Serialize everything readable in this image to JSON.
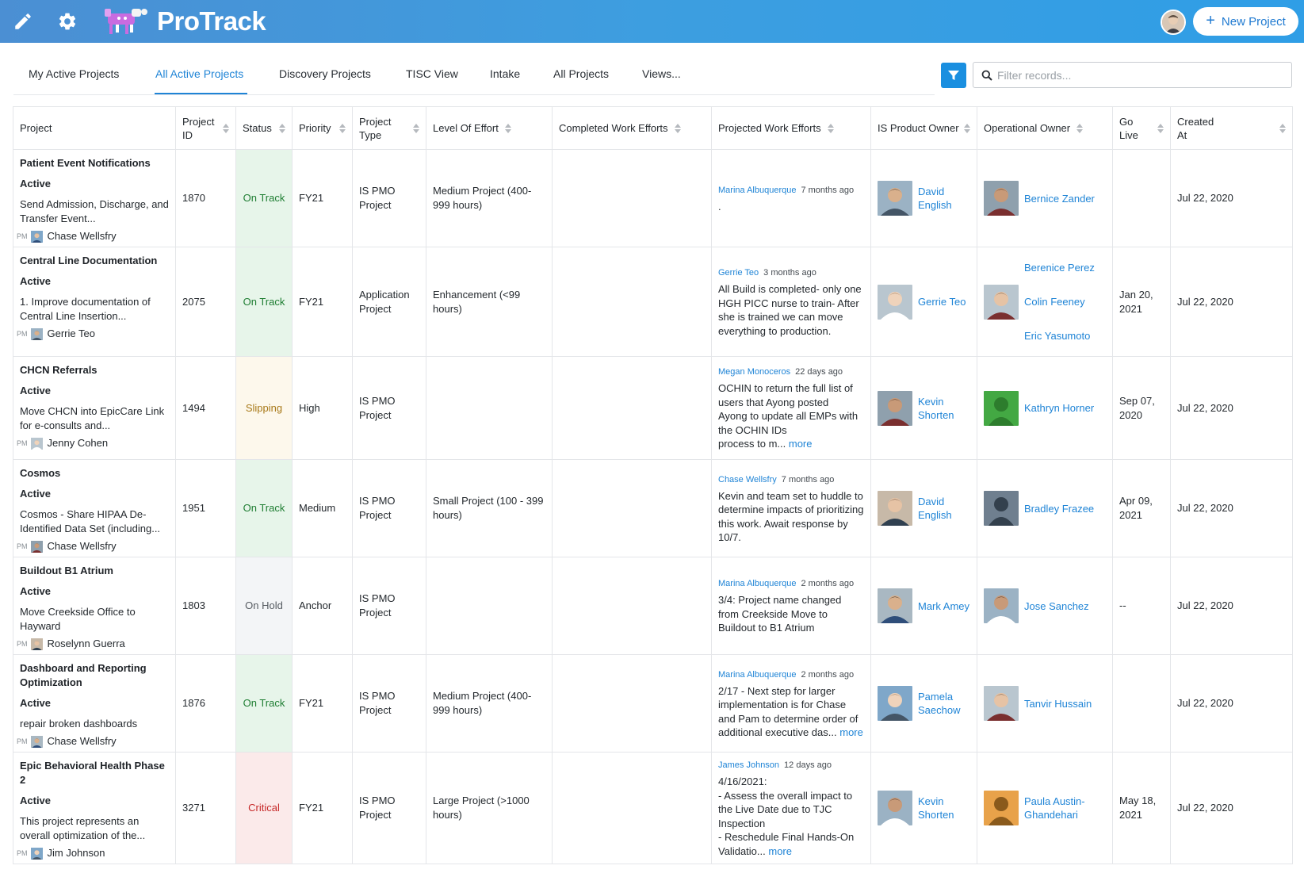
{
  "app": {
    "logo_text": "ProTrack"
  },
  "header": {
    "new_project_label": "New Project"
  },
  "tabs": [
    {
      "label": "My Active Projects"
    },
    {
      "label": "All Active Projects",
      "active": true
    },
    {
      "label": "Discovery Projects"
    },
    {
      "label": "TISC View"
    },
    {
      "label": "Intake"
    },
    {
      "label": "All Projects"
    },
    {
      "label": "Views..."
    }
  ],
  "filter": {
    "placeholder": "Filter records..."
  },
  "columns": {
    "project": "Project",
    "project_id": "Project ID",
    "status": "Status",
    "priority": "Priority",
    "project_type": "Project Type",
    "level_of_effort": "Level Of Effort",
    "completed_work_efforts": "Completed Work Efforts",
    "projected_work_efforts": "Projected Work Efforts",
    "is_product_owner": "IS Product Owner",
    "operational_owner": "Operational Owner",
    "go_live": "Go Live",
    "created_at": "Created At"
  },
  "colors": {
    "header_gradient_start": "#4b8fd3",
    "header_gradient_end": "#2f9ee6",
    "link_blue": "#1f84d6",
    "on_track": "#1e7d32",
    "slipping": "#a87918",
    "on_hold": "#555b61",
    "critical": "#c62828"
  },
  "rows": [
    {
      "name": "Patient Event Notifications",
      "state": "Active",
      "desc": "Send Admission, Discharge, and Transfer Event...",
      "pm_tag": "PM",
      "pm": "Chase Wellsfry",
      "id": "1870",
      "status": "On Track",
      "priority": "FY21",
      "type": "IS PMO Project",
      "effort": "Medium Project (400-999 hours)",
      "completed": "",
      "update_author": "Marina Albuquerque",
      "update_time": "7 months ago",
      "update_text": ".",
      "update_more": "",
      "is_owner": "David English",
      "op_owners": [
        "Bernice Zander"
      ],
      "go_live": "",
      "created": "Jul 22, 2020"
    },
    {
      "name": "Central Line Documentation",
      "state": "Active",
      "desc": "1. Improve documentation of Central Line Insertion...",
      "pm_tag": "PM",
      "pm": "Gerrie Teo",
      "id": "2075",
      "status": "On Track",
      "priority": "FY21",
      "type": "Application Project",
      "effort": "Enhancement (<99 hours)",
      "completed": "",
      "update_author": "Gerrie Teo",
      "update_time": "3 months ago",
      "update_text": "All Build is completed- only one HGH PICC nurse to train- After she is trained we can move everything to production.",
      "update_more": "",
      "is_owner": "Gerrie Teo",
      "op_owners": [
        "Berenice Perez",
        "Colin Feeney",
        "Eric Yasumoto"
      ],
      "go_live": "Jan 20, 2021",
      "created": "Jul 22, 2020"
    },
    {
      "name": "CHCN Referrals",
      "state": "Active",
      "desc": "Move CHCN into EpicCare Link for e-consults and...",
      "pm_tag": "PM",
      "pm": "Jenny Cohen",
      "id": "1494",
      "status": "Slipping",
      "priority": "High",
      "type": "IS PMO Project",
      "effort": "",
      "completed": "",
      "update_author": "Megan Monoceros",
      "update_time": "22 days ago",
      "update_text": "OCHIN to return the full list of users that Ayong posted\nAyong to update all EMPs with the OCHIN IDs\nprocess to m...",
      "update_more": "more",
      "is_owner": "Kevin Shorten",
      "op_owners": [
        "Kathryn Horner"
      ],
      "go_live": "Sep 07, 2020",
      "created": "Jul 22, 2020"
    },
    {
      "name": "Cosmos",
      "state": "Active",
      "desc": "Cosmos - Share HIPAA De-Identified Data Set (including...",
      "pm_tag": "PM",
      "pm": "Chase Wellsfry",
      "id": "1951",
      "status": "On Track",
      "priority": "Medium",
      "type": "IS PMO Project",
      "effort": "Small Project (100 - 399 hours)",
      "completed": "",
      "update_author": "Chase Wellsfry",
      "update_time": "7 months ago",
      "update_text": "Kevin and team set to huddle to determine impacts of prioritizing this work. Await response by 10/7.",
      "update_more": "",
      "is_owner": "David English",
      "op_owners": [
        "Bradley Frazee"
      ],
      "go_live": "Apr 09, 2021",
      "created": "Jul 22, 2020"
    },
    {
      "name": "Buildout B1 Atrium",
      "state": "Active",
      "desc": "Move Creekside Office to Hayward",
      "pm_tag": "PM",
      "pm": "Roselynn Guerra",
      "id": "1803",
      "status": "On Hold",
      "priority": "Anchor",
      "type": "IS PMO Project",
      "effort": "",
      "completed": "",
      "update_author": "Marina Albuquerque",
      "update_time": "2 months ago",
      "update_text": "3/4: Project name changed from Creekside Move to Buildout to B1 Atrium",
      "update_more": "",
      "is_owner": "Mark Amey",
      "op_owners": [
        "Jose Sanchez"
      ],
      "go_live": "--",
      "created": "Jul 22, 2020"
    },
    {
      "name": "Dashboard and Reporting Optimization",
      "state": "Active",
      "desc": "repair broken dashboards",
      "pm_tag": "PM",
      "pm": "Chase Wellsfry",
      "id": "1876",
      "status": "On Track",
      "priority": "FY21",
      "type": "IS PMO Project",
      "effort": "Medium Project (400-999 hours)",
      "completed": "",
      "update_author": "Marina Albuquerque",
      "update_time": "2 months ago",
      "update_text": "2/17 - Next step for larger implementation is for Chase and Pam to determine order of additional executive das...",
      "update_more": "more",
      "is_owner": "Pamela Saechow",
      "op_owners": [
        "Tanvir Hussain"
      ],
      "go_live": "",
      "created": "Jul 22, 2020"
    },
    {
      "name": "Epic Behavioral Health Phase 2",
      "state": "Active",
      "desc": "This project represents an overall optimization of the...",
      "pm_tag": "PM",
      "pm": "Jim Johnson",
      "id": "3271",
      "status": "Critical",
      "priority": "FY21",
      "type": "IS PMO Project",
      "effort": "Large Project (>1000 hours)",
      "completed": "",
      "update_author": "James Johnson",
      "update_time": "12 days ago",
      "update_text": "4/16/2021:\n- Assess the overall impact to the Live Date due to TJC Inspection\n- Reschedule Final Hands-On Validatio...",
      "update_more": "more",
      "is_owner": "Kevin Shorten",
      "op_owners": [
        "Paula Austin-Ghandehari"
      ],
      "go_live": "May 18, 2021",
      "created": "Jul 22, 2020"
    }
  ]
}
